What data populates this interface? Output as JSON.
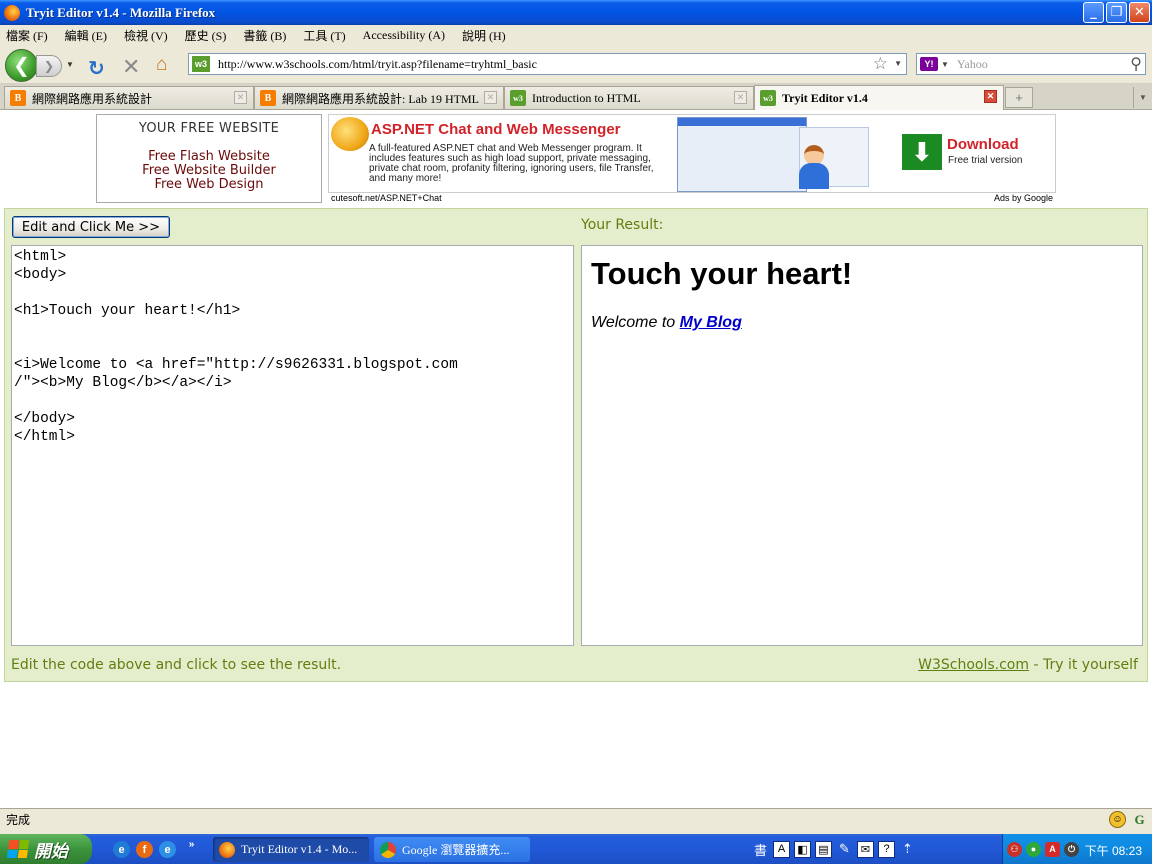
{
  "window": {
    "title": "Tryit Editor v1.4 - Mozilla Firefox"
  },
  "menu": [
    "檔案 (F)",
    "編輯 (E)",
    "檢視 (V)",
    "歷史 (S)",
    "書籤 (B)",
    "工具 (T)",
    "Accessibility (A)",
    "說明 (H)"
  ],
  "nav": {
    "url": "http://www.w3schools.com/html/tryit.asp?filename=tryhtml_basic",
    "search_placeholder": "Yahoo",
    "search_engine": "Y!"
  },
  "tabs": [
    {
      "label": "網際網路應用系統設計",
      "icon": "blogger-icon",
      "active": false
    },
    {
      "label": "網際網路應用系統設計: Lab 19 HTML",
      "icon": "blogger-icon",
      "active": false
    },
    {
      "label": "Introduction to HTML",
      "icon": "w3-icon",
      "active": false
    },
    {
      "label": "Tryit Editor v1.4",
      "icon": "w3-icon",
      "active": true
    }
  ],
  "ads": {
    "left_heading": "YOUR FREE WEBSITE",
    "left_links": [
      "Free Flash Website",
      "Free Website Builder",
      "Free Web Design"
    ],
    "banner_title": "ASP.NET Chat and Web Messenger",
    "banner_desc": "A full-featured ASP.NET chat and Web Messenger program. It includes features such as high load support, private messaging, private chat room, profanity filtering, ignoring users, file Transfer, and many more!",
    "download_title": "Download",
    "download_sub": "Free trial version",
    "source": "cutesoft.net/ASP.NET+Chat",
    "ads_by": "Ads by Google"
  },
  "editor": {
    "submit_label": "Edit and Click Me >>",
    "result_label": "Your Result:",
    "code": "<html>\n<body>\n\n<h1>Touch your heart!</h1>\n\n\n<i>Welcome to <a href=\"http://s9626331.blogspot.com\n/\"><b>My Blog</b></a></i>\n\n</body>\n</html>",
    "result_heading": "Touch your heart!",
    "result_welcome": "Welcome to ",
    "result_link": "My Blog",
    "footer_left": "Edit the code above and click to see the result.",
    "footer_link": "W3Schools.com",
    "footer_suffix": " - Try it yourself"
  },
  "status": {
    "text": "完成"
  },
  "taskbar": {
    "start_label": "開始",
    "tasks": [
      {
        "label": "Tryit Editor v1.4 - Mo...",
        "active": true
      },
      {
        "label": "Google 瀏覽器擴充...",
        "active": false
      }
    ],
    "ime_char": "書",
    "clock": "下午 08:23"
  },
  "colors": {
    "accent_green": "#617f10",
    "panel_bg": "#e5eecc",
    "titlebar_blue": "#0054e3"
  }
}
